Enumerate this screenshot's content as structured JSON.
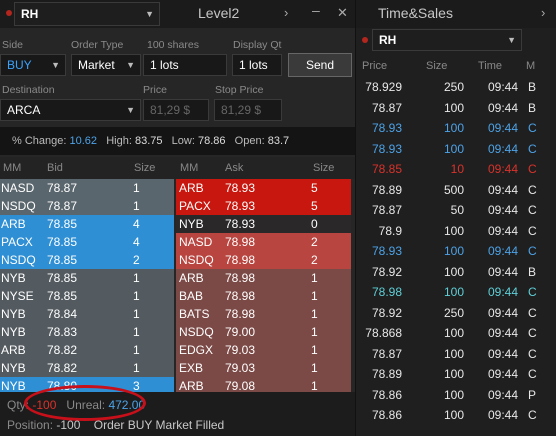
{
  "level2": {
    "symbol": "RH",
    "title": "Level2",
    "form": {
      "side_label": "Side",
      "side_value": "BUY",
      "order_type_label": "Order Type",
      "order_type_value": "Market",
      "shares_label": "100 shares",
      "lots_value": "1 lots",
      "display_qty_label": "Display Qt",
      "display_qty_value": "1 lots",
      "send_label": "Send",
      "destination_label": "Destination",
      "destination_value": "ARCA",
      "price_label": "Price",
      "price_value": "81,29 $",
      "stop_price_label": "Stop Price",
      "stop_price_value": "81,29 $"
    },
    "stats": {
      "change_label": "% Change:",
      "change_value": "10.62",
      "high_label": "High:",
      "high_value": "83.75",
      "low_label": "Low:",
      "low_value": "78.86",
      "open_label": "Open:",
      "open_value": "83.7"
    },
    "bid_headers": [
      "MM",
      "Bid",
      "Size"
    ],
    "ask_headers": [
      "MM",
      "Ask",
      "Size"
    ],
    "bids": [
      {
        "mm": "NASD",
        "price": "78.87",
        "size": "1",
        "tier": 0
      },
      {
        "mm": "NSDQ",
        "price": "78.87",
        "size": "1",
        "tier": 0
      },
      {
        "mm": "ARB",
        "price": "78.85",
        "size": "4",
        "tier": 1
      },
      {
        "mm": "PACX",
        "price": "78.85",
        "size": "4",
        "tier": 1
      },
      {
        "mm": "NSDQ",
        "price": "78.85",
        "size": "2",
        "tier": 1
      },
      {
        "mm": "NYB",
        "price": "78.85",
        "size": "1",
        "tier": 2
      },
      {
        "mm": "NYSE",
        "price": "78.85",
        "size": "1",
        "tier": 2
      },
      {
        "mm": "NYB",
        "price": "78.84",
        "size": "1",
        "tier": 2
      },
      {
        "mm": "NYB",
        "price": "78.83",
        "size": "1",
        "tier": 2
      },
      {
        "mm": "ARB",
        "price": "78.82",
        "size": "1",
        "tier": 2
      },
      {
        "mm": "NYB",
        "price": "78.82",
        "size": "1",
        "tier": 2
      },
      {
        "mm": "NYB",
        "price": "78.80",
        "size": "3",
        "tier": 1
      }
    ],
    "asks": [
      {
        "mm": "ARB",
        "price": "78.93",
        "size": "5",
        "tier": 0
      },
      {
        "mm": "PACX",
        "price": "78.93",
        "size": "5",
        "tier": 0
      },
      {
        "mm": "NYB",
        "price": "78.93",
        "size": "0",
        "tier": 3
      },
      {
        "mm": "NASD",
        "price": "78.98",
        "size": "2",
        "tier": 1
      },
      {
        "mm": "NSDQ",
        "price": "78.98",
        "size": "2",
        "tier": 1
      },
      {
        "mm": "ARB",
        "price": "78.98",
        "size": "1",
        "tier": 2
      },
      {
        "mm": "BAB",
        "price": "78.98",
        "size": "1",
        "tier": 2
      },
      {
        "mm": "BATS",
        "price": "78.98",
        "size": "1",
        "tier": 2
      },
      {
        "mm": "NSDQ",
        "price": "79.00",
        "size": "1",
        "tier": 2
      },
      {
        "mm": "EDGX",
        "price": "79.03",
        "size": "1",
        "tier": 2
      },
      {
        "mm": "EXB",
        "price": "79.03",
        "size": "1",
        "tier": 2
      },
      {
        "mm": "ARB",
        "price": "79.08",
        "size": "1",
        "tier": 2
      }
    ],
    "footer": {
      "qty_label": "Qty:",
      "qty_value": "-100",
      "unreal_label": "Unreal:",
      "unreal_value": "472.00",
      "position_label": "Position:",
      "position_value": "-100",
      "status": "Order BUY Market Filled"
    }
  },
  "timesales": {
    "title": "Time&Sales",
    "symbol": "RH",
    "headers": [
      "Price",
      "Size",
      "Time",
      "M"
    ],
    "rows": [
      {
        "price": "78.929",
        "size": "250",
        "time": "09:44",
        "m": "B",
        "color": "#e8e8e8"
      },
      {
        "price": "78.87",
        "size": "100",
        "time": "09:44",
        "m": "B",
        "color": "#e8e8e8"
      },
      {
        "price": "78.93",
        "size": "100",
        "time": "09:44",
        "m": "C",
        "color": "#4da3e8"
      },
      {
        "price": "78.93",
        "size": "100",
        "time": "09:44",
        "m": "C",
        "color": "#4da3e8"
      },
      {
        "price": "78.85",
        "size": "10",
        "time": "09:44",
        "m": "C",
        "color": "#d9322b"
      },
      {
        "price": "78.89",
        "size": "500",
        "time": "09:44",
        "m": "C",
        "color": "#e8e8e8"
      },
      {
        "price": "78.87",
        "size": "50",
        "time": "09:44",
        "m": "C",
        "color": "#e8e8e8"
      },
      {
        "price": "78.9",
        "size": "100",
        "time": "09:44",
        "m": "C",
        "color": "#e8e8e8"
      },
      {
        "price": "78.93",
        "size": "100",
        "time": "09:44",
        "m": "C",
        "color": "#4da3e8"
      },
      {
        "price": "78.92",
        "size": "100",
        "time": "09:44",
        "m": "B",
        "color": "#e8e8e8"
      },
      {
        "price": "78.98",
        "size": "100",
        "time": "09:44",
        "m": "C",
        "color": "#5fd0d8"
      },
      {
        "price": "78.92",
        "size": "250",
        "time": "09:44",
        "m": "C",
        "color": "#e8e8e8"
      },
      {
        "price": "78.868",
        "size": "100",
        "time": "09:44",
        "m": "C",
        "color": "#e8e8e8"
      },
      {
        "price": "78.87",
        "size": "100",
        "time": "09:44",
        "m": "C",
        "color": "#e8e8e8"
      },
      {
        "price": "78.89",
        "size": "100",
        "time": "09:44",
        "m": "C",
        "color": "#e8e8e8"
      },
      {
        "price": "78.86",
        "size": "100",
        "time": "09:44",
        "m": "P",
        "color": "#e8e8e8"
      },
      {
        "price": "78.86",
        "size": "100",
        "time": "09:44",
        "m": "C",
        "color": "#e8e8e8"
      }
    ]
  },
  "colors": {
    "bid_tier": [
      "#5a666d",
      "#2e8fd4",
      "#535b60"
    ],
    "ask_tier": [
      "#c8170e",
      "#b8453f",
      "#7c4a46",
      "#2a2828"
    ],
    "blue_text": "#4da3e8"
  }
}
